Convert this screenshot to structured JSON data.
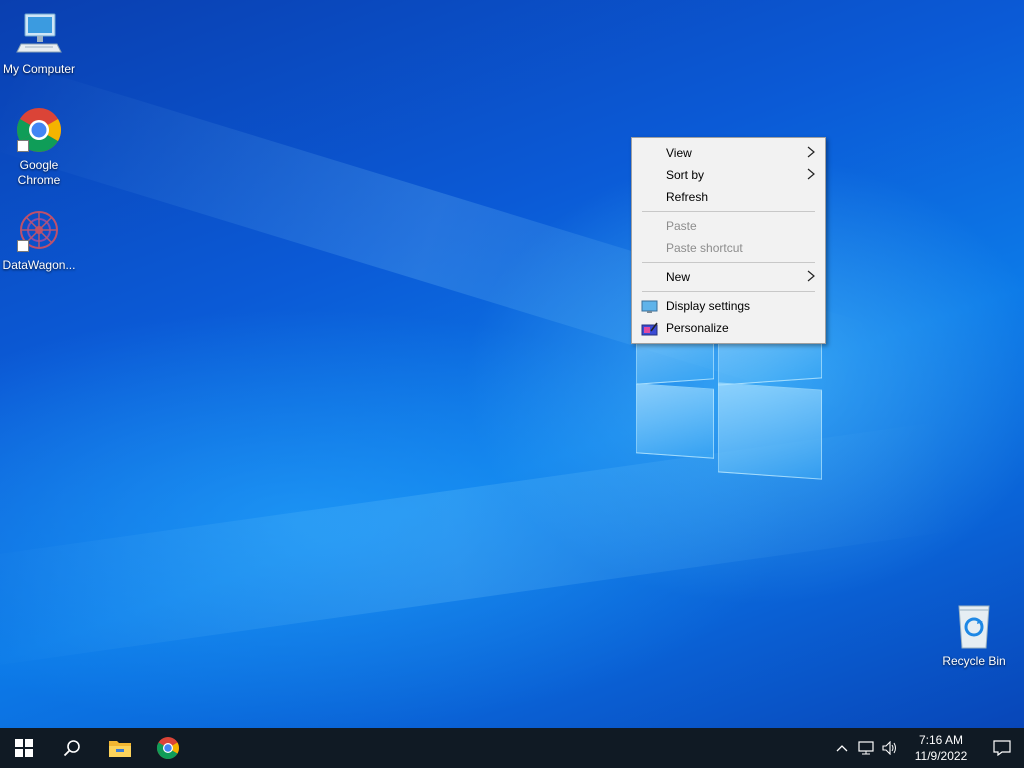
{
  "desktop": {
    "icons": [
      {
        "label": "My Computer",
        "icon": "computer-icon"
      },
      {
        "label": "Google Chrome",
        "icon": "chrome-icon"
      },
      {
        "label": "DataWagon...",
        "icon": "datawagon-icon"
      },
      {
        "label": "Recycle Bin",
        "icon": "recycle-bin-icon"
      }
    ]
  },
  "context_menu": {
    "items": [
      {
        "label": "View",
        "has_submenu": true,
        "enabled": true
      },
      {
        "label": "Sort by",
        "has_submenu": true,
        "enabled": true
      },
      {
        "label": "Refresh",
        "has_submenu": false,
        "enabled": true
      },
      {
        "label": "Paste",
        "has_submenu": false,
        "enabled": false
      },
      {
        "label": "Paste shortcut",
        "has_submenu": false,
        "enabled": false
      },
      {
        "label": "New",
        "has_submenu": true,
        "enabled": true
      },
      {
        "label": "Display settings",
        "icon": "display-settings-icon",
        "enabled": true
      },
      {
        "label": "Personalize",
        "icon": "personalize-icon",
        "enabled": true
      }
    ],
    "submenu_arrow": ">"
  },
  "taskbar": {
    "pinned": [
      "start-icon",
      "search-icon",
      "file-explorer-icon",
      "chrome-icon"
    ],
    "clock": {
      "time": "7:16 AM",
      "date": "11/9/2022"
    },
    "tray": {
      "chevron": "^"
    }
  },
  "colors": {
    "taskbar": "#101a24",
    "menu_bg": "#f2f2f2",
    "disabled_text": "#8d8d8d"
  }
}
